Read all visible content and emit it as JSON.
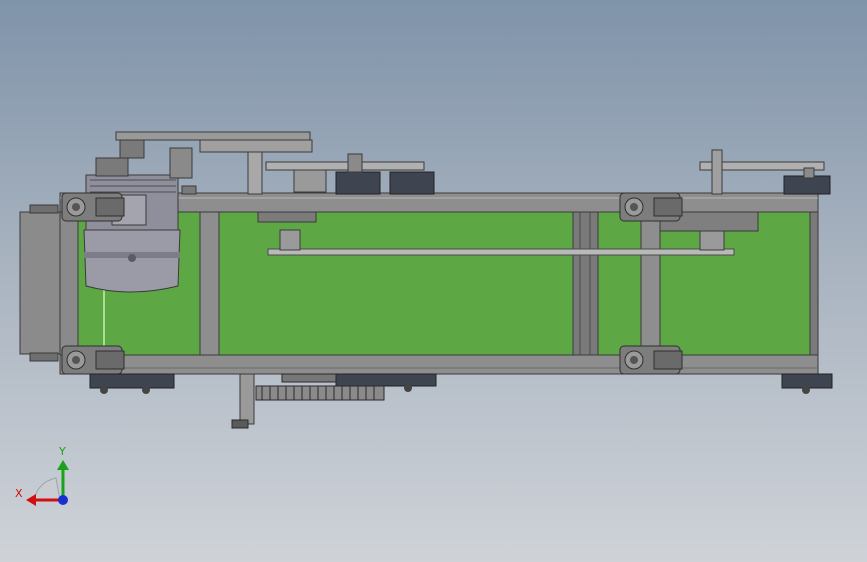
{
  "viewport": {
    "background_top": "#7f93a9",
    "background_bottom": "#cfd3d8"
  },
  "colors": {
    "belt": "#5ea745",
    "frame": "#8a8a8a",
    "frame_dark": "#5a5a5a",
    "motor": "#8e8f9a",
    "axis_x": "#d01010",
    "axis_y": "#1aa21a",
    "axis_z": "#1a2fd0"
  },
  "model": {
    "components": [
      "conveyor-frame",
      "belt",
      "drive-motor",
      "chain-drive",
      "casters",
      "sprockets",
      "gear"
    ]
  },
  "triad": {
    "x_label": "X",
    "y_label": "Y"
  }
}
